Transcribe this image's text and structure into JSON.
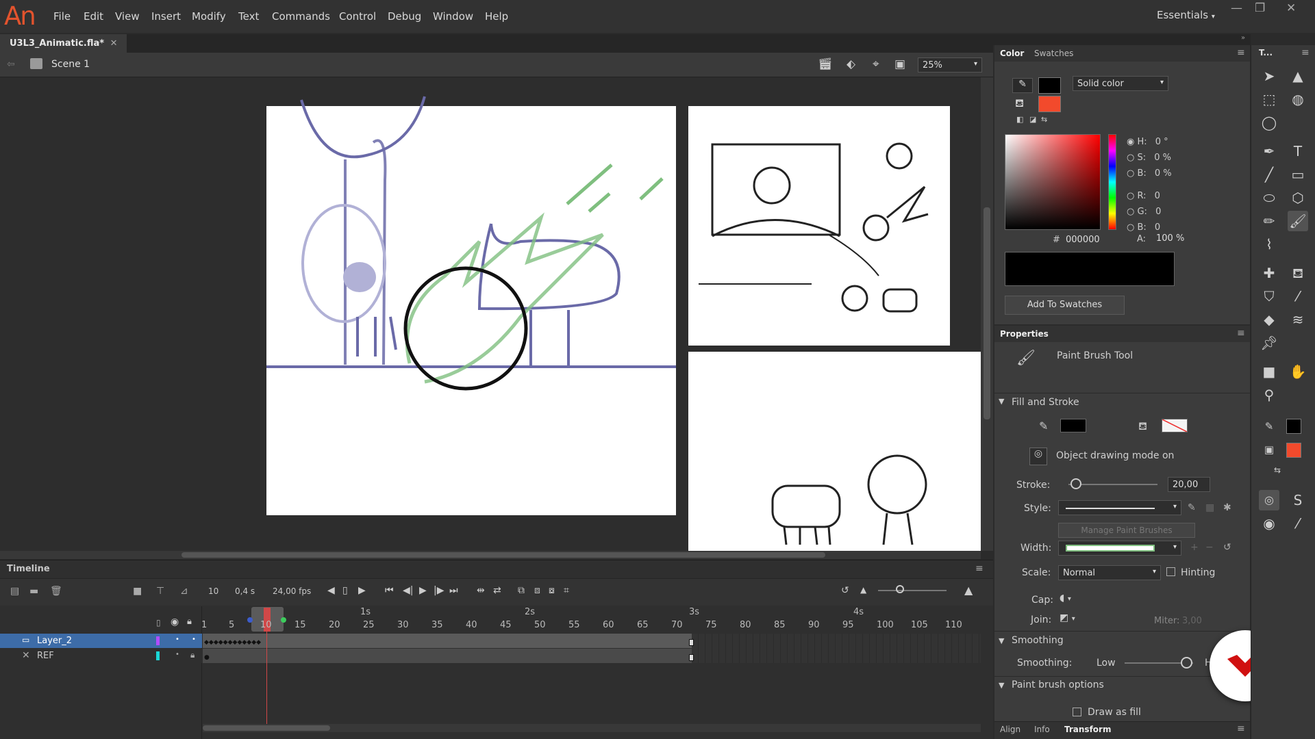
{
  "app": {
    "logo": "An"
  },
  "menu": [
    "File",
    "Edit",
    "View",
    "Insert",
    "Modify",
    "Text",
    "Commands",
    "Control",
    "Debug",
    "Window",
    "Help"
  ],
  "workspace": "Essentials",
  "document": {
    "tab_title": "U3L3_Animatic.fla*",
    "scene": "Scene 1",
    "zoom": "25%"
  },
  "timeline": {
    "title": "Timeline",
    "current_frame": "10",
    "time": "0,4 s",
    "fps": "24,00 fps",
    "seconds": [
      "1s",
      "2s",
      "3s",
      "4s"
    ],
    "frame_numbers": [
      "1",
      "5",
      "10",
      "15",
      "20",
      "25",
      "30",
      "35",
      "40",
      "45",
      "50",
      "55",
      "60",
      "65",
      "70",
      "75",
      "80",
      "85",
      "90",
      "95",
      "100",
      "105",
      "110"
    ],
    "layers": [
      {
        "name": "Layer_2",
        "selected": true,
        "color": "#b14dff"
      },
      {
        "name": "REF",
        "selected": false,
        "color": "#1ad6d6"
      }
    ]
  },
  "color_panel": {
    "tabs": [
      "Color",
      "Swatches"
    ],
    "fill_type": "Solid color",
    "H": "0 °",
    "S": "0 %",
    "B": "0 %",
    "R": "0",
    "G": "0",
    "Bv": "0",
    "hex_label": "#",
    "hex": "000000",
    "alpha_label": "A:",
    "alpha": "100 %",
    "add_button": "Add To Swatches",
    "stroke_color": "#000000",
    "fill_color": "#f24a2c"
  },
  "properties": {
    "title": "Properties",
    "tool_name": "Paint Brush Tool",
    "section_fill": "Fill and Stroke",
    "object_drawing": "Object drawing mode on",
    "stroke_label": "Stroke:",
    "stroke_value": "20,00",
    "style_label": "Style:",
    "manage_brushes": "Manage Paint Brushes",
    "width_label": "Width:",
    "scale_label": "Scale:",
    "scale_value": "Normal",
    "hinting": "Hinting",
    "cap_label": "Cap:",
    "join_label": "Join:",
    "miter_label": "Miter:",
    "miter_value": "3,00",
    "section_smoothing": "Smoothing",
    "smoothing_label": "Smoothing:",
    "smoothing_low": "Low",
    "smoothing_high": "H",
    "section_brush": "Paint brush options",
    "draw_as_fill": "Draw as fill"
  },
  "bottom_tabs": [
    "Align",
    "Info",
    "Transform"
  ],
  "tools_header": "T..."
}
